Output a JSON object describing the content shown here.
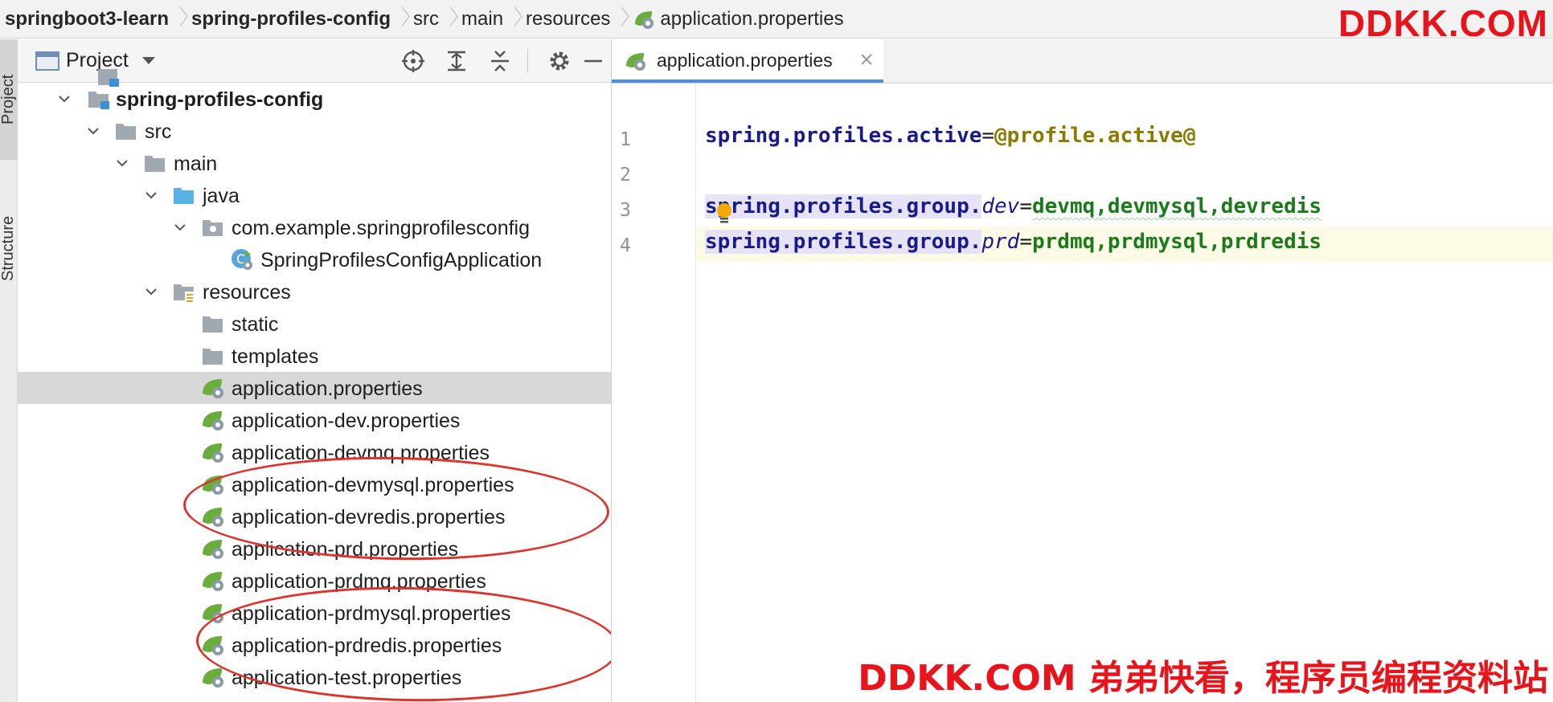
{
  "breadcrumb": {
    "items": [
      "springboot3-learn",
      "spring-profiles-config",
      "src",
      "main",
      "resources",
      "application.properties"
    ]
  },
  "watermark": {
    "top": "DDKK.COM",
    "bottom": "DDKK.COM 弟弟快看，程序员编程资料站"
  },
  "tool_strip": {
    "project_tab": "Project",
    "structure_tab": "Structure"
  },
  "project_panel": {
    "title": "Project"
  },
  "tree": {
    "module": "spring-profiles-config",
    "src": "src",
    "main": "main",
    "java": "java",
    "package": "com.example.springprofilesconfig",
    "app_class": "SpringProfilesConfigApplication",
    "resources": "resources",
    "static": "static",
    "templates": "templates",
    "files": [
      "application.properties",
      "application-dev.properties",
      "application-devmq.properties",
      "application-devmysql.properties",
      "application-devredis.properties",
      "application-prd.properties",
      "application-prdmq.properties",
      "application-prdmysql.properties",
      "application-prdredis.properties",
      "application-test.properties"
    ],
    "selected_file": "application.properties"
  },
  "editor": {
    "tab_label": "application.properties",
    "line_numbers": [
      "1",
      "2",
      "3",
      "4"
    ],
    "line1": {
      "key": "spring.profiles.active",
      "eq": "=",
      "value": "@profile.active@"
    },
    "line3": {
      "key": "spring.profiles.group.",
      "group": "dev",
      "eq": "=",
      "value": "devmq,devmysql,devredis"
    },
    "line4": {
      "key": "spring.profiles.group.",
      "group": "prd",
      "eq": "=",
      "value": "prdmq,prdmysql,prdredis"
    }
  },
  "colors": {
    "accent_tab": "#4a8df2",
    "annotation_red": "#d8362e",
    "watermark_red": "#e8141c",
    "spring_green": "#6aad3d"
  }
}
